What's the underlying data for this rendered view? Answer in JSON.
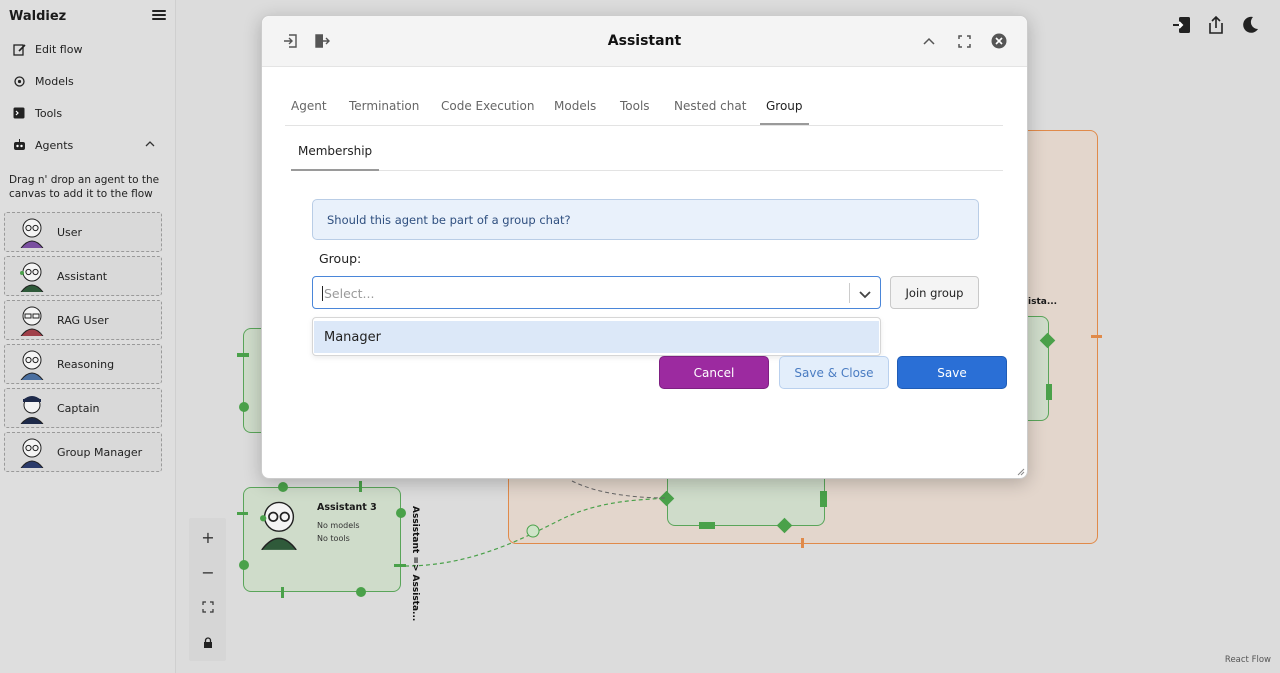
{
  "app": {
    "brand": "Waldiez"
  },
  "sidebar": {
    "nav": [
      {
        "label": "Edit flow",
        "icon": "edit-icon"
      },
      {
        "label": "Models",
        "icon": "models-icon"
      },
      {
        "label": "Tools",
        "icon": "terminal-icon"
      },
      {
        "label": "Agents",
        "icon": "robot-icon"
      }
    ],
    "hint": "Drag n' drop an agent to the canvas to add it to the flow",
    "agents": [
      {
        "label": "User"
      },
      {
        "label": "Assistant"
      },
      {
        "label": "RAG User"
      },
      {
        "label": "Reasoning"
      },
      {
        "label": "Captain"
      },
      {
        "label": "Group Manager"
      }
    ]
  },
  "canvas": {
    "node": {
      "title": "Assistant 3",
      "models": "No models",
      "tools": "No tools"
    },
    "edge_label": "Assistant => Assista...",
    "right_node_label": "ista...",
    "attribution": "React Flow",
    "controls": {
      "zoom_in": "+",
      "zoom_out": "−"
    }
  },
  "modal": {
    "title": "Assistant",
    "tabs": [
      {
        "label": "Agent"
      },
      {
        "label": "Termination"
      },
      {
        "label": "Code Execution"
      },
      {
        "label": "Models"
      },
      {
        "label": "Tools"
      },
      {
        "label": "Nested chat"
      },
      {
        "label": "Group"
      }
    ],
    "active_tab": "Group",
    "subtab": "Membership",
    "info": "Should this agent be part of a group chat?",
    "group_label": "Group:",
    "select": {
      "placeholder": "Select...",
      "options": [
        "Manager"
      ]
    },
    "join_button": "Join group",
    "buttons": {
      "cancel": "Cancel",
      "save_close": "Save & Close",
      "save": "Save"
    },
    "colors": {
      "cancel": "#9c2aa0",
      "save": "#2a6fd6",
      "select_border": "#4a86d9"
    }
  }
}
